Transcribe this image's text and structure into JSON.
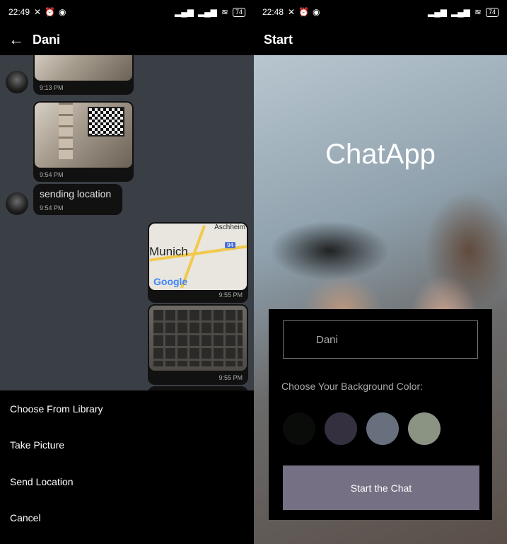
{
  "left": {
    "status": {
      "time": "22:49",
      "battery": "74"
    },
    "header": {
      "title": "Dani"
    },
    "messages": [
      {
        "time": "9:13 PM"
      },
      {
        "time": "9:54 PM"
      },
      {
        "text": "sending location",
        "time": "9:54 PM"
      },
      {
        "map_city": "Munich",
        "map_town": "Aschheim",
        "map_hwy": "94",
        "map_logo": "Google",
        "time": "9:55 PM"
      },
      {
        "time": "9:55 PM"
      }
    ],
    "action_sheet": [
      "Choose From Library",
      "Take Picture",
      "Send Location",
      "Cancel"
    ]
  },
  "right": {
    "status": {
      "time": "22:48",
      "battery": "74"
    },
    "header": {
      "title": "Start"
    },
    "app_title": "ChatApp",
    "name_input": {
      "value": "Dani"
    },
    "color_label": "Choose Your Background Color:",
    "colors": [
      "#090C08",
      "#474056",
      "#8A95A5",
      "#B9C6AE"
    ],
    "start_button": {
      "label": "Start the Chat",
      "color": "#757083"
    }
  }
}
